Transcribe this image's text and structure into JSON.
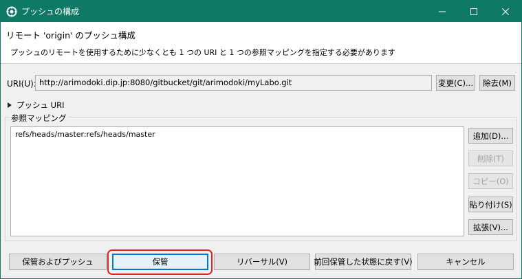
{
  "window": {
    "title": "プッシュの構成"
  },
  "header": {
    "title": "リモート 'origin' のプッシュ構成",
    "description": "プッシュのリモートを使用するために少なくとも 1 つの URI と 1 つの参照マッピングを指定する必要があります"
  },
  "uri": {
    "label": "URI(U):",
    "value": "http://arimodoki.dip.jp:8080/gitbucket/git/arimodoki/myLabo.git",
    "change_label": "変更(C)...",
    "remove_label": "除去(M)"
  },
  "push_uri": {
    "label": "プッシュ URI"
  },
  "refspec": {
    "group_label": "参照マッピング",
    "items": [
      "refs/heads/master:refs/heads/master"
    ],
    "buttons": {
      "add": "追加(D)...",
      "delete": "削除(T)",
      "copy": "コピー(O)",
      "paste": "貼り付け(S)",
      "expand": "拡張(V)..."
    }
  },
  "footer": {
    "save_push": "保管およびプッシュ",
    "save": "保管",
    "revert": "リバーサル(V)",
    "restore": "前回保管した状態に戻す(V)",
    "cancel": "キャンセル"
  },
  "colors": {
    "titlebar": "#0e7a66",
    "highlight": "#e52020",
    "focus": "#0078d7"
  }
}
